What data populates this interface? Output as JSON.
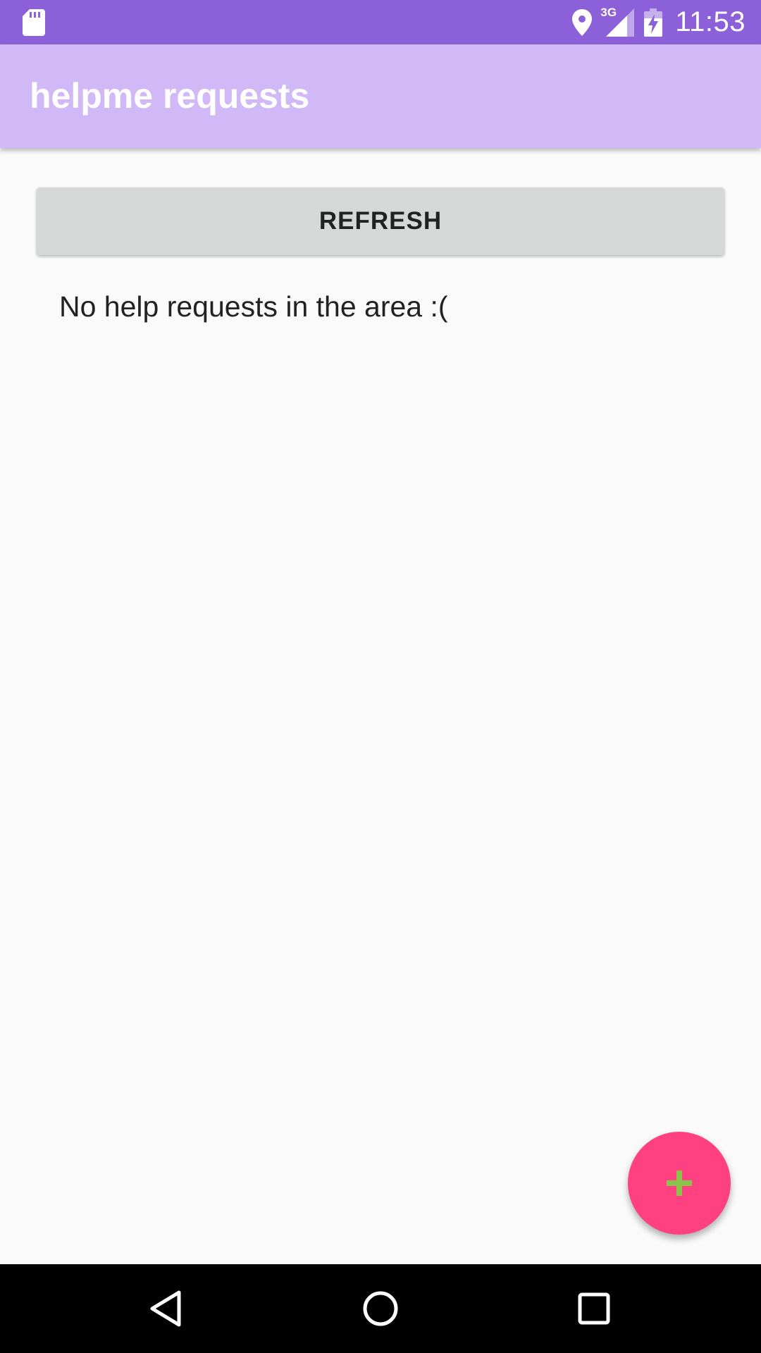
{
  "status_bar": {
    "time": "11:53",
    "network": "3G",
    "icons": [
      "sd-card-icon",
      "location-icon",
      "signal-icon",
      "battery-charging-icon"
    ]
  },
  "app_bar": {
    "title": "helpme requests"
  },
  "main": {
    "refresh_label": "REFRESH",
    "empty_message": "No help requests in the area :("
  },
  "fab": {
    "icon": "plus-icon"
  },
  "nav_bar": {
    "icons": [
      "back-icon",
      "home-icon",
      "recents-icon"
    ]
  },
  "colors": {
    "status_bar": "#8c60d9",
    "app_bar": "#d1b8f7",
    "fab": "#ff4081",
    "fab_icon": "#8bc34a",
    "button": "#d6d7d7"
  }
}
